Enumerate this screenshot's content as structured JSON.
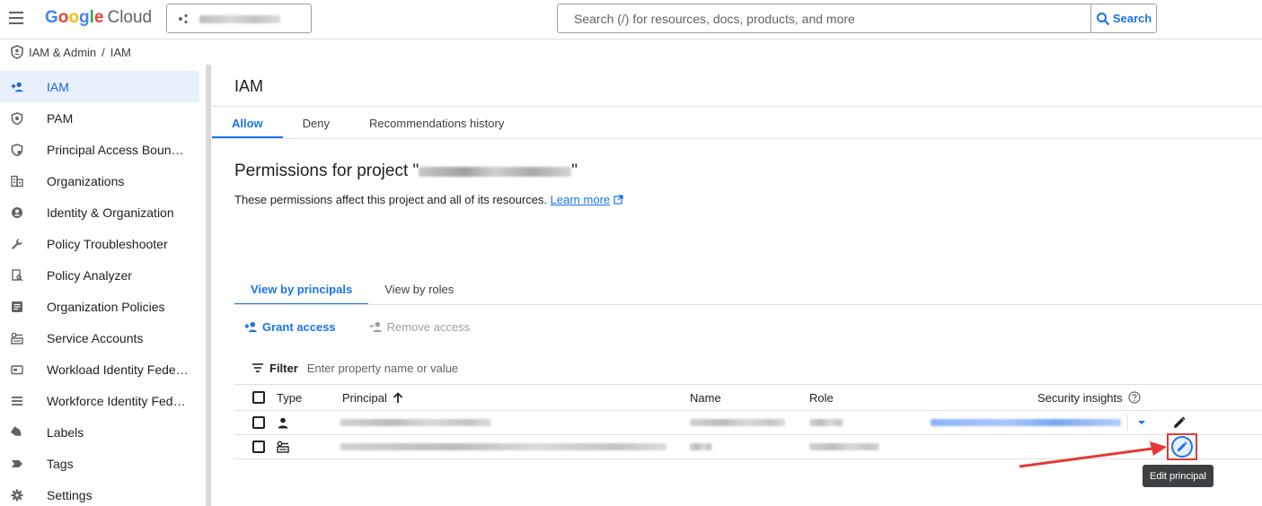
{
  "topbar": {
    "logo_g": "Google",
    "logo_cloud": "Cloud",
    "search_placeholder": "Search (/) for resources, docs, products, and more",
    "search_button": "Search"
  },
  "breadcrumb": {
    "section": "IAM & Admin",
    "separator": "/",
    "page": "IAM"
  },
  "sidebar": {
    "items": [
      {
        "label": "IAM",
        "icon": "person-add-icon",
        "active": true
      },
      {
        "label": "PAM",
        "icon": "shield-icon"
      },
      {
        "label": "Principal Access Boun…",
        "icon": "policy-boundary-icon"
      },
      {
        "label": "Organizations",
        "icon": "organizations-icon"
      },
      {
        "label": "Identity & Organization",
        "icon": "account-circle-icon"
      },
      {
        "label": "Policy Troubleshooter",
        "icon": "wrench-icon"
      },
      {
        "label": "Policy Analyzer",
        "icon": "document-search-icon"
      },
      {
        "label": "Organization Policies",
        "icon": "article-icon"
      },
      {
        "label": "Service Accounts",
        "icon": "service-account-icon"
      },
      {
        "label": "Workload Identity Fede…",
        "icon": "id-card-icon"
      },
      {
        "label": "Workforce Identity Fed…",
        "icon": "list-icon"
      },
      {
        "label": "Labels",
        "icon": "label-icon"
      },
      {
        "label": "Tags",
        "icon": "tag-icon"
      },
      {
        "label": "Settings",
        "icon": "gear-icon"
      }
    ]
  },
  "main": {
    "title": "IAM",
    "tabs": [
      {
        "label": "Allow",
        "active": true
      },
      {
        "label": "Deny"
      },
      {
        "label": "Recommendations history"
      }
    ],
    "permissions_title_prefix": "Permissions for project \"",
    "permissions_title_suffix": "\"",
    "permissions_desc": "These permissions affect this project and all of its resources.",
    "learn_more": "Learn more",
    "subtabs": [
      {
        "label": "View by principals",
        "active": true
      },
      {
        "label": "View by roles"
      }
    ],
    "grant_access": "Grant access",
    "remove_access": "Remove access",
    "filter_label": "Filter",
    "filter_placeholder": "Enter property name or value",
    "table": {
      "columns": {
        "type": "Type",
        "principal": "Principal",
        "name": "Name",
        "role": "Role",
        "security": "Security insights"
      }
    },
    "tooltip": "Edit principal"
  },
  "colors": {
    "accent": "#1a73e8",
    "annotation": "#e53935"
  }
}
